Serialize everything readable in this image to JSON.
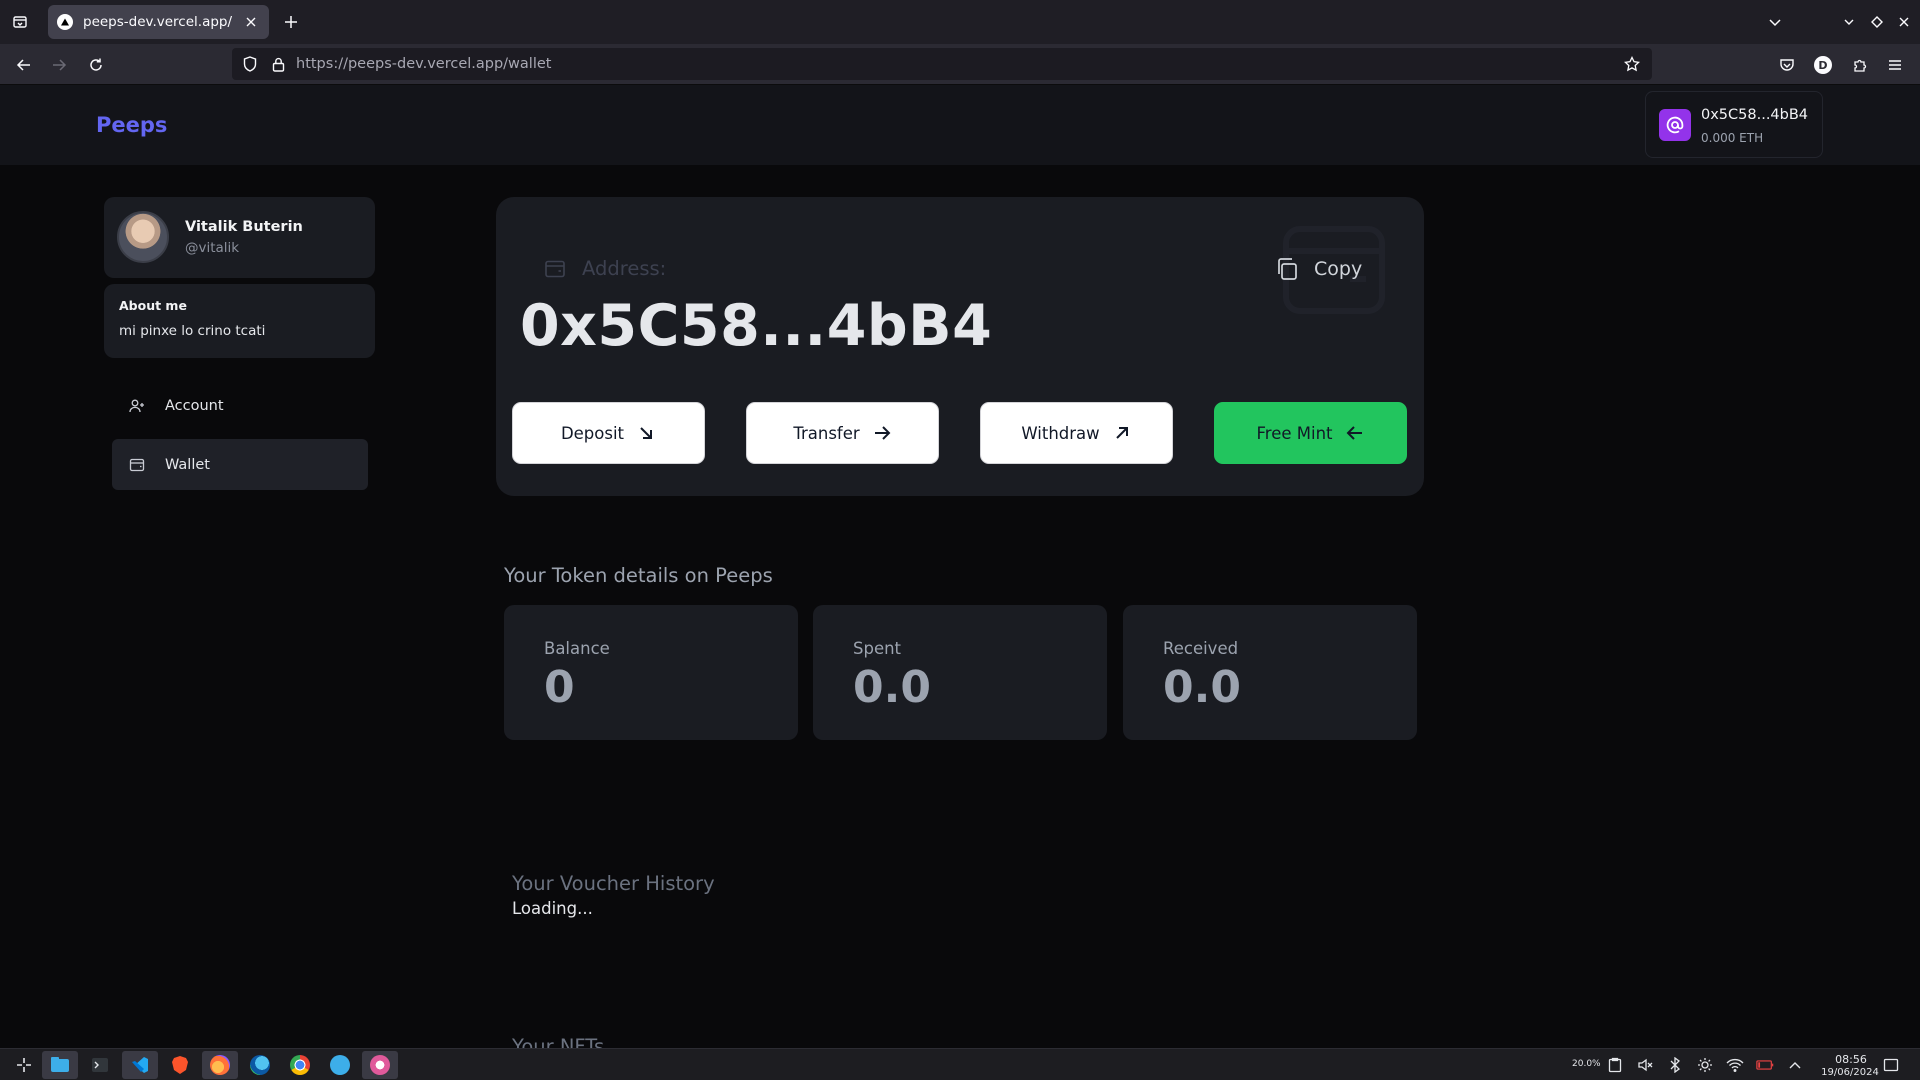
{
  "browser": {
    "tab_title": "peeps-dev.vercel.app/",
    "url_host": "https://peeps-dev.vercel.app",
    "url_path": "/wallet"
  },
  "header": {
    "logo": "Peeps",
    "wallet_chip": {
      "address": "0x5C58...4bB4",
      "balance": "0.000 ETH"
    }
  },
  "profile": {
    "name": "Vitalik Buterin",
    "handle": "@vitalik",
    "about_title": "About me",
    "about_text": "mi pinxe lo crino tcati"
  },
  "sidebar": {
    "items": [
      {
        "label": "Account",
        "icon": "user-icon"
      },
      {
        "label": "Wallet",
        "icon": "wallet-icon"
      }
    ]
  },
  "wallet": {
    "address_label": "Address:",
    "address": "0x5C58...4bB4",
    "copy_label": "Copy",
    "actions": [
      {
        "label": "Deposit",
        "icon": "arrow-down-right-icon"
      },
      {
        "label": "Transfer",
        "icon": "arrow-right-icon"
      },
      {
        "label": "Withdraw",
        "icon": "arrow-up-right-icon"
      },
      {
        "label": "Free Mint",
        "icon": "arrow-left-icon"
      }
    ],
    "free_mint_color": "#22c55e"
  },
  "tokens": {
    "heading": "Your Token details on Peeps",
    "stats": [
      {
        "label": "Balance",
        "value": "0"
      },
      {
        "label": "Spent",
        "value": "0.0"
      },
      {
        "label": "Received",
        "value": "0.0"
      }
    ]
  },
  "vouchers": {
    "heading": "Your Voucher History",
    "status": "Loading..."
  },
  "nfts": {
    "heading": "Your NFTs"
  },
  "taskbar": {
    "tray_percent": "20.0%",
    "time": "08:56",
    "date": "19/06/2024"
  },
  "colors": {
    "accent": "#6366f1",
    "chip_icon": "#9333ea"
  }
}
